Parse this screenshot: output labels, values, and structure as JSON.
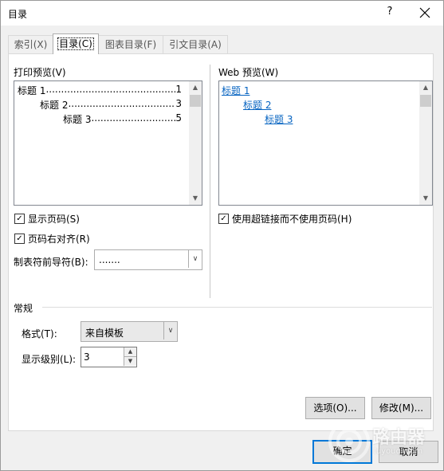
{
  "window": {
    "title": "目录",
    "help_label": "?",
    "close_label": "✕"
  },
  "tabs": [
    {
      "label": "索引(X)"
    },
    {
      "label": "目录(C)"
    },
    {
      "label": "图表目录(F)"
    },
    {
      "label": "引文目录(A)"
    }
  ],
  "print_preview": {
    "label": "打印预览(V)",
    "entries": [
      {
        "text": "标题 1",
        "dots": "..................................................................",
        "page": "1"
      },
      {
        "text": "标题 2",
        "dots": "..................................................................",
        "page": "3"
      },
      {
        "text": "标题 3",
        "dots": "..................................................................",
        "page": "5"
      }
    ]
  },
  "web_preview": {
    "label": "Web 预览(W)",
    "links": [
      "标题 1",
      "标题 2",
      "标题 3"
    ]
  },
  "options": {
    "show_page_numbers": {
      "label": "显示页码(S)",
      "checked": true,
      "mark": "✓"
    },
    "right_align": {
      "label": "页码右对齐(R)",
      "checked": true,
      "mark": "✓"
    },
    "tab_leader_label": "制表符前导符(B):",
    "tab_leader_value": ".......",
    "use_hyperlinks": {
      "label": "使用超链接而不使用页码(H)",
      "checked": true,
      "mark": "✓"
    }
  },
  "general": {
    "section_label": "常规",
    "format_label": "格式(T):",
    "format_value": "来自模板",
    "levels_label": "显示级别(L):",
    "levels_value": "3"
  },
  "buttons": {
    "options": "选项(O)...",
    "modify": "修改(M)...",
    "ok": "确定",
    "cancel": "取消"
  },
  "watermark": {
    "text": "路由器",
    "sub": "luyouqi.com"
  },
  "icons": {
    "chevron_down": "∨",
    "arrow_up": "▲",
    "arrow_down": "▼"
  },
  "colors": {
    "link": "#0563c1",
    "default_button_border": "#0078d7"
  }
}
